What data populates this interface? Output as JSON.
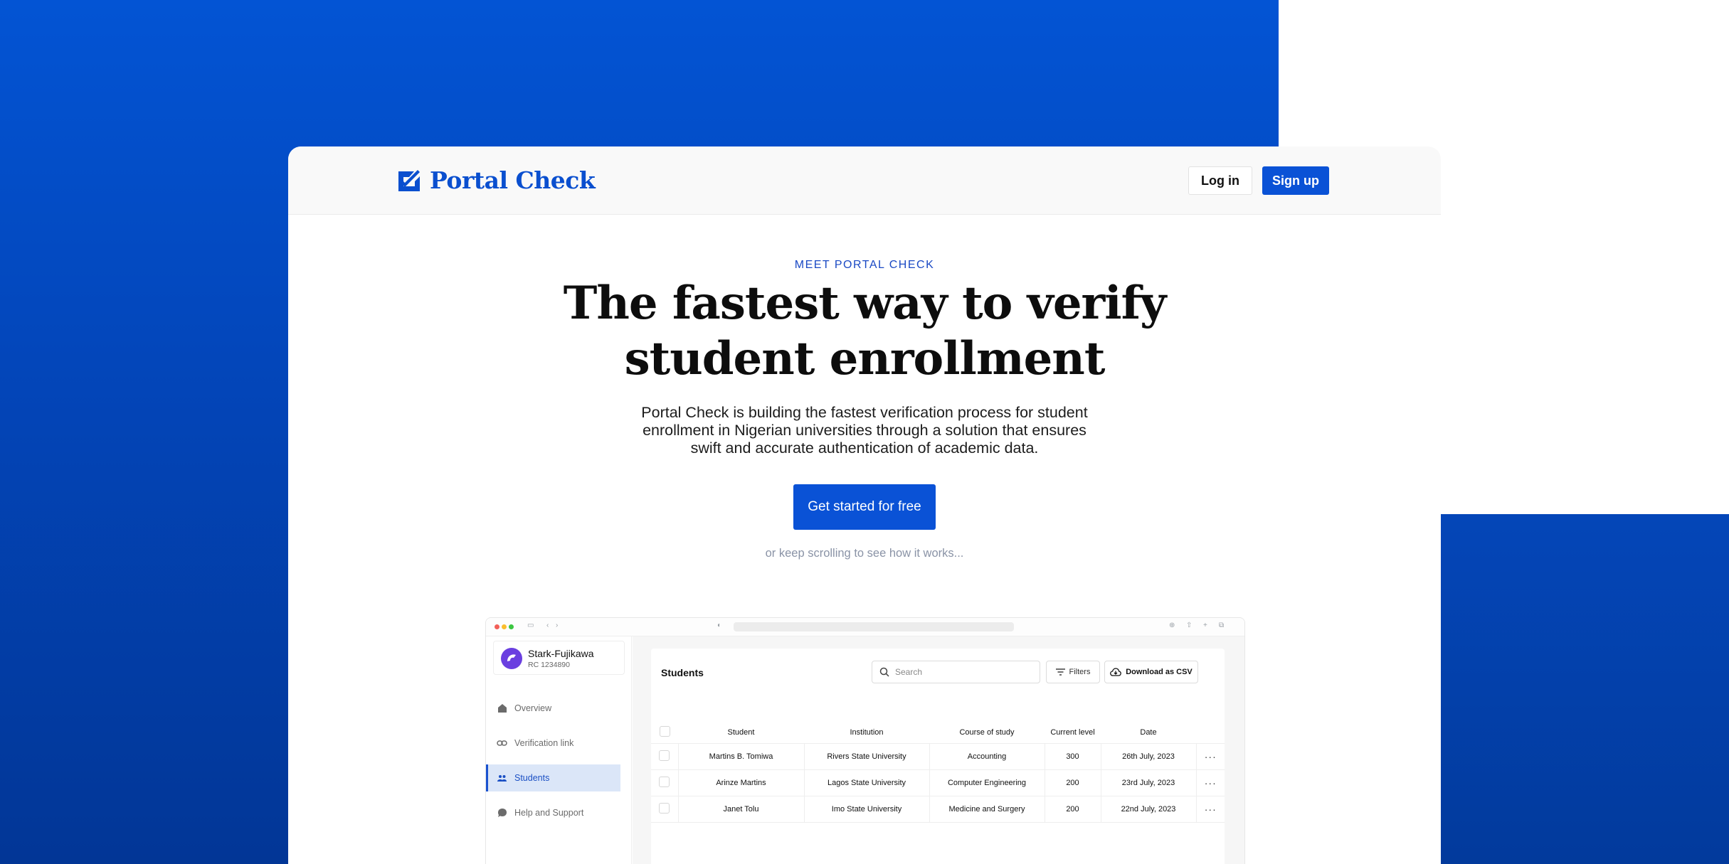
{
  "brand": {
    "name": "Portal Check",
    "color": "#0a4fcf"
  },
  "nav": {
    "login_label": "Log in",
    "signup_label": "Sign up"
  },
  "hero": {
    "eyebrow": "MEET PORTAL CHECK",
    "headline_line1": "The fastest way to verify",
    "headline_line2": "student enrollment",
    "subtext": "Portal Check is building the fastest verification process for student enrollment in Nigerian universities through a solution that ensures swift and accurate authentication of academic data.",
    "cta_label": "Get started for free",
    "scroll_note": "or keep scrolling to see how it works..."
  },
  "mockup": {
    "org": {
      "name": "Stark-Fujikawa",
      "rc": "RC 1234890"
    },
    "sidebar": {
      "items": [
        {
          "label": "Overview",
          "icon": "home-icon",
          "active": false
        },
        {
          "label": "Verification link",
          "icon": "link-icon",
          "active": false
        },
        {
          "label": "Students",
          "icon": "users-icon",
          "active": true
        },
        {
          "label": "Help and Support",
          "icon": "chat-icon",
          "active": false
        }
      ]
    },
    "students": {
      "title": "Students",
      "search_placeholder": "Search",
      "filters_label": "Filters",
      "download_label": "Download as CSV",
      "columns": [
        "Student",
        "Institution",
        "Course of study",
        "Current level",
        "Date"
      ],
      "rows": [
        {
          "student": "Martins B. Tomiwa",
          "institution": "Rivers State University",
          "course": "Accounting",
          "level": "300",
          "date": "26th July, 2023"
        },
        {
          "student": "Arinze Martins",
          "institution": "Lagos State University",
          "course": "Computer Engineering",
          "level": "200",
          "date": "23rd July, 2023"
        },
        {
          "student": "Janet Tolu",
          "institution": "Imo State University",
          "course": "Medicine and Surgery",
          "level": "200",
          "date": "22nd July, 2023"
        }
      ]
    }
  }
}
